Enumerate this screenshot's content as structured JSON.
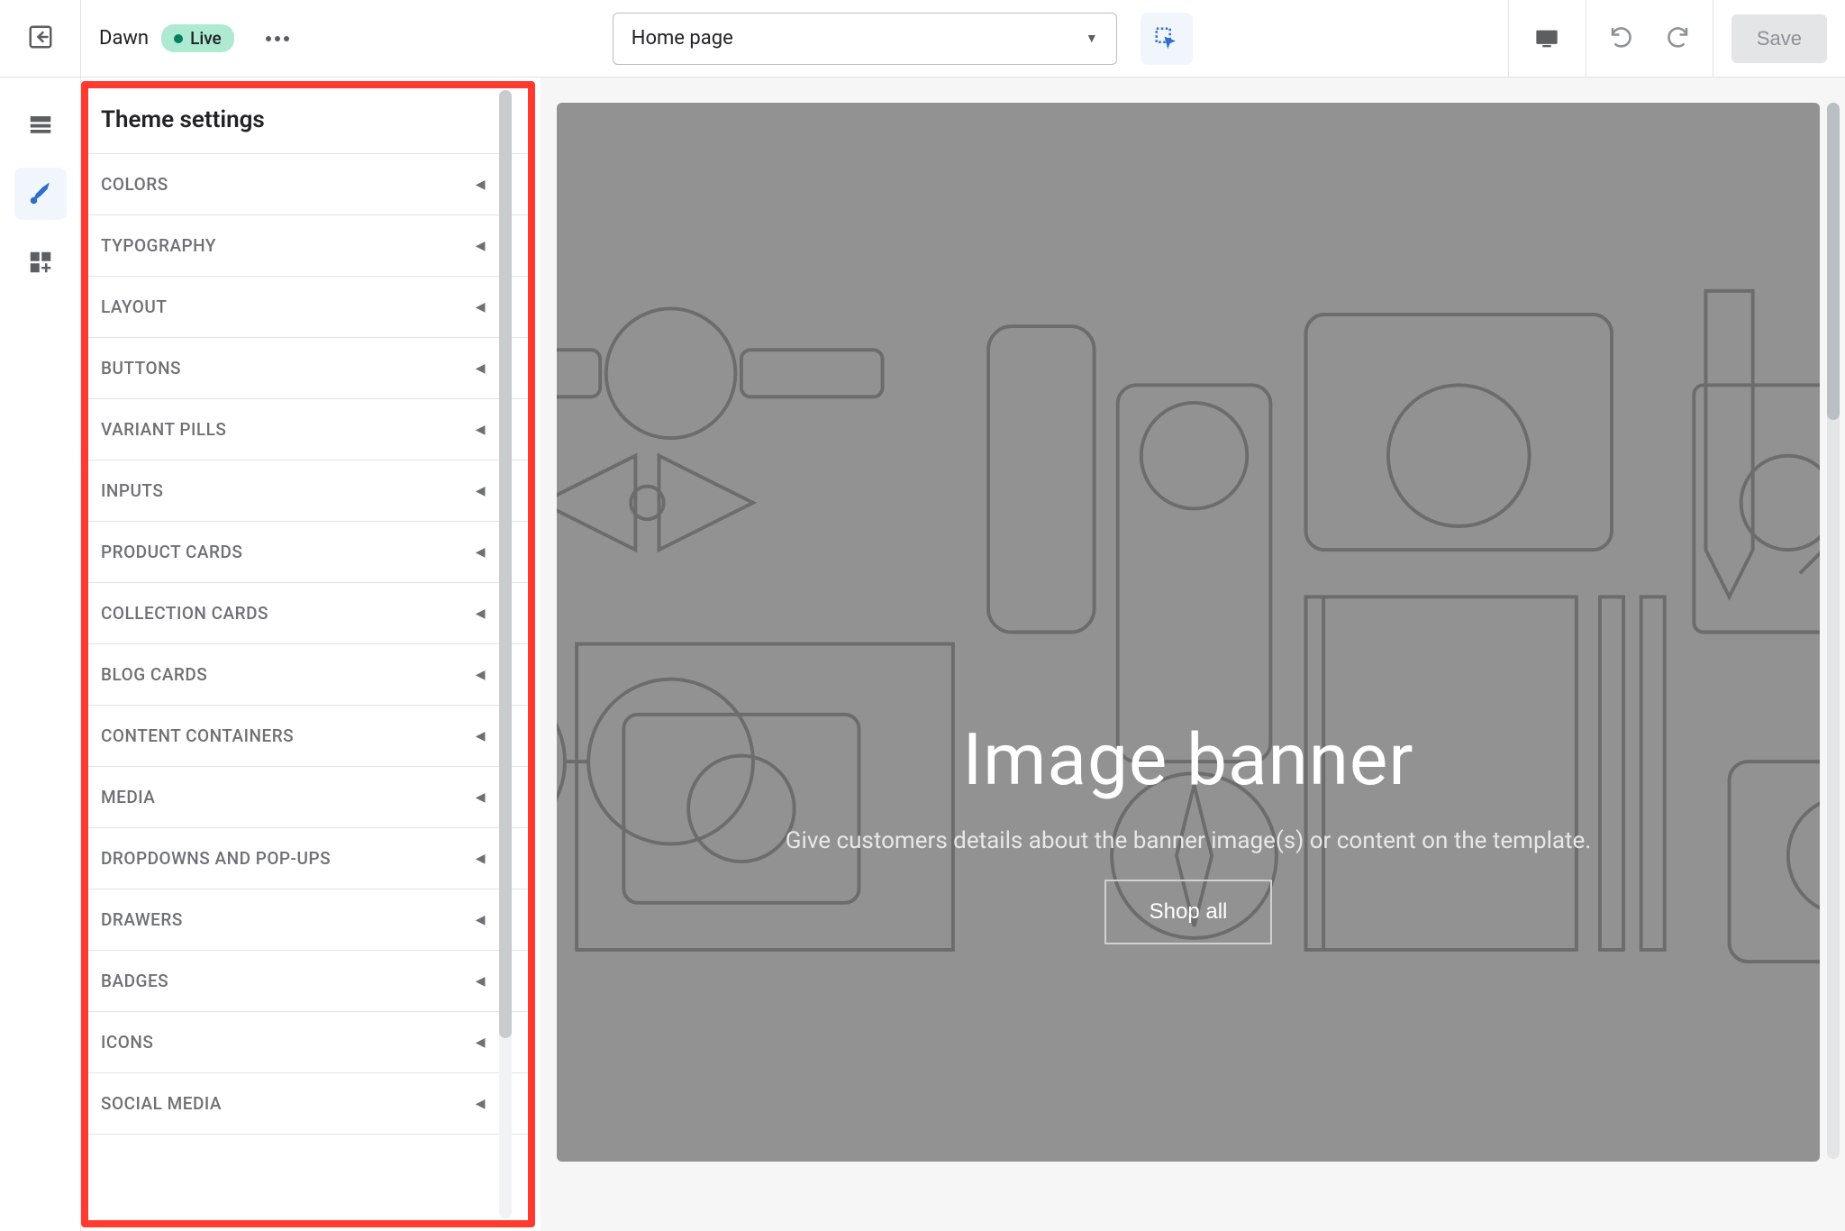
{
  "topbar": {
    "theme_name": "Dawn",
    "live_label": "Live",
    "template_selected": "Home page",
    "save_label": "Save"
  },
  "panel": {
    "title": "Theme settings",
    "items": [
      "COLORS",
      "TYPOGRAPHY",
      "LAYOUT",
      "BUTTONS",
      "VARIANT PILLS",
      "INPUTS",
      "PRODUCT CARDS",
      "COLLECTION CARDS",
      "BLOG CARDS",
      "CONTENT CONTAINERS",
      "MEDIA",
      "DROPDOWNS AND POP-UPS",
      "DRAWERS",
      "BADGES",
      "ICONS",
      "SOCIAL MEDIA"
    ]
  },
  "preview": {
    "hero_title": "Image banner",
    "hero_subtitle": "Give customers details about the banner image(s) or content on the template.",
    "hero_cta": "Shop all"
  }
}
